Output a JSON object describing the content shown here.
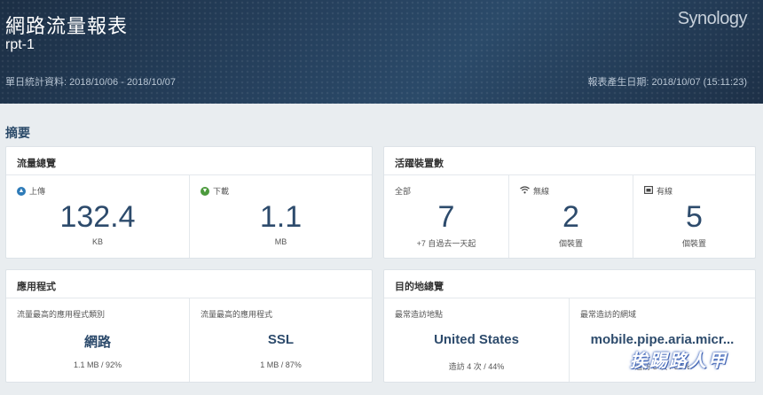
{
  "header": {
    "title": "網路流量報表",
    "subtitle": "rpt-1",
    "range": "單日統計資料: 2018/10/06 - 2018/10/07",
    "generated": "報表產生日期: 2018/10/07 (15:11:23)",
    "logo": "Synology"
  },
  "summary_title": "摘要",
  "traffic": {
    "title": "流量總覽",
    "upload": {
      "label": "上傳",
      "value": "132.4",
      "unit": "KB"
    },
    "download": {
      "label": "下載",
      "value": "1.1",
      "unit": "MB"
    }
  },
  "devices": {
    "title": "活躍裝置數",
    "all": {
      "label": "全部",
      "value": "7",
      "sub": "+7 自過去一天起"
    },
    "wireless": {
      "label": "無線",
      "value": "2",
      "sub": "個裝置"
    },
    "wired": {
      "label": "有線",
      "value": "5",
      "sub": "個裝置"
    }
  },
  "apps": {
    "title": "應用程式",
    "category": {
      "label": "流量最高的應用程式類別",
      "value": "網路",
      "sub": "1.1 MB / 92%"
    },
    "app": {
      "label": "流量最高的應用程式",
      "value": "SSL",
      "sub": "1 MB / 87%"
    }
  },
  "destinations": {
    "title": "目的地總覽",
    "location": {
      "label": "最常造訪地點",
      "value": "United States",
      "sub": "造訪 4 次 / 44%"
    },
    "domain": {
      "label": "最常造訪的網域",
      "value": "mobile.pipe.aria.micr...",
      "sub": "造訪 3 次 / 33%"
    }
  },
  "watermark": "挨踢路人甲",
  "colors": {
    "accent": "#2d4b6c",
    "header": "#26415e",
    "upload": "#2e7bb8",
    "download": "#4c9a3d"
  }
}
